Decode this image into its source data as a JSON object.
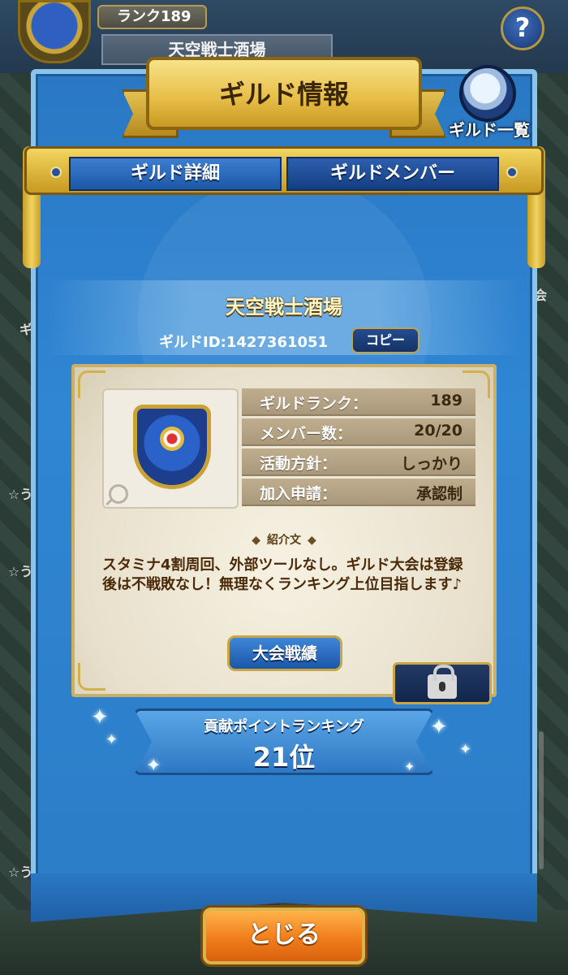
{
  "header": {
    "rank_label": "ランク189",
    "guild_name": "天空戦士酒場",
    "help_icon_text": "?"
  },
  "dialog": {
    "title": "ギルド情報",
    "guild_list_label": "ギルド一覧",
    "tabs": [
      {
        "label": "ギルド詳細",
        "active": true
      },
      {
        "label": "ギルドメンバー",
        "active": false
      }
    ],
    "guild_name": "天空戦士酒場",
    "guild_id": "ギルドID:1427361051",
    "copy_label": "コピー",
    "stats": [
      {
        "label": "ギルドランク：",
        "value": "189"
      },
      {
        "label": "メンバー数：",
        "value": "20/20"
      },
      {
        "label": "活動方針：",
        "value": "しっかり"
      },
      {
        "label": "加入申請：",
        "value": "承認制"
      }
    ],
    "intro_title": "紹介文",
    "intro_text": "スタミナ4割周回、外部ツールなし。ギルド大会は登録後は不戦敗なし！無理なくランキング上位目指します♪",
    "results_button": "大会戦績",
    "ranking_title": "貢献ポイントランキング",
    "ranking_value": "21位",
    "close_button": "とじる"
  },
  "side": {
    "left_1": "ギル",
    "left_2": "☆う",
    "left_3": "☆う",
    "left_4": "☆う",
    "right_1": "会"
  },
  "icons": {
    "help": "question-icon",
    "guild_list": "magnifier-icon",
    "zoom": "zoom-icon",
    "lock": "lock-icon",
    "intro_marks": "diamond-icon"
  },
  "colors": {
    "panel_blue": "#2c7dc7",
    "gold": "#e8c04a",
    "close_orange": "#f07e1a",
    "parchment": "#efe8d6"
  }
}
